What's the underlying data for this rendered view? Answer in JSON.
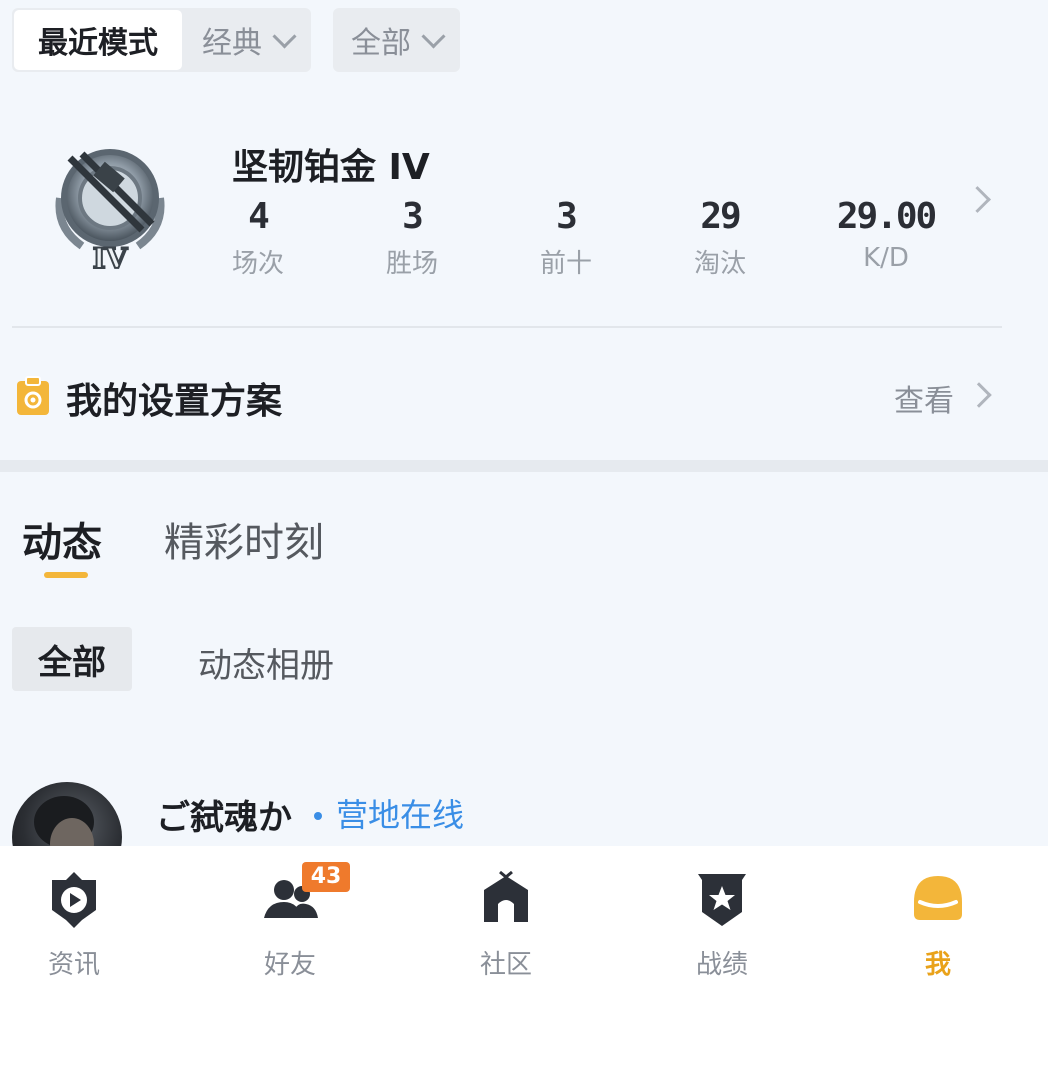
{
  "filters": {
    "segment": {
      "active_label": "最近模式",
      "mode_label": "经典"
    },
    "scope_label": "全部"
  },
  "rank": {
    "title": "坚韧铂金 IV",
    "badge_roman": "IV",
    "stats": [
      {
        "value": "4",
        "label": "场次"
      },
      {
        "value": "3",
        "label": "胜场"
      },
      {
        "value": "3",
        "label": "前十"
      },
      {
        "value": "29",
        "label": "淘汰"
      },
      {
        "value": "29.00",
        "label": "K/D"
      }
    ]
  },
  "settings": {
    "title": "我的设置方案",
    "view_label": "查看"
  },
  "tabs": {
    "feed": "动态",
    "highlights": "精彩时刻"
  },
  "subfilters": {
    "all": "全部",
    "album": "动态相册"
  },
  "post": {
    "username": "ご弑魂か",
    "status": "营地在线"
  },
  "bottom_nav": {
    "items": [
      {
        "label": "资讯",
        "icon": "news-play-icon"
      },
      {
        "label": "好友",
        "icon": "friends-icon",
        "badge": "43"
      },
      {
        "label": "社区",
        "icon": "community-house-icon"
      },
      {
        "label": "战绩",
        "icon": "record-star-shield-icon"
      },
      {
        "label": "我",
        "icon": "helmet-icon",
        "active": true
      }
    ]
  },
  "colors": {
    "accent": "#f3b63a",
    "active_nav": "#e9a21a",
    "link": "#3a8ee6",
    "badge": "#ef7a2c"
  }
}
